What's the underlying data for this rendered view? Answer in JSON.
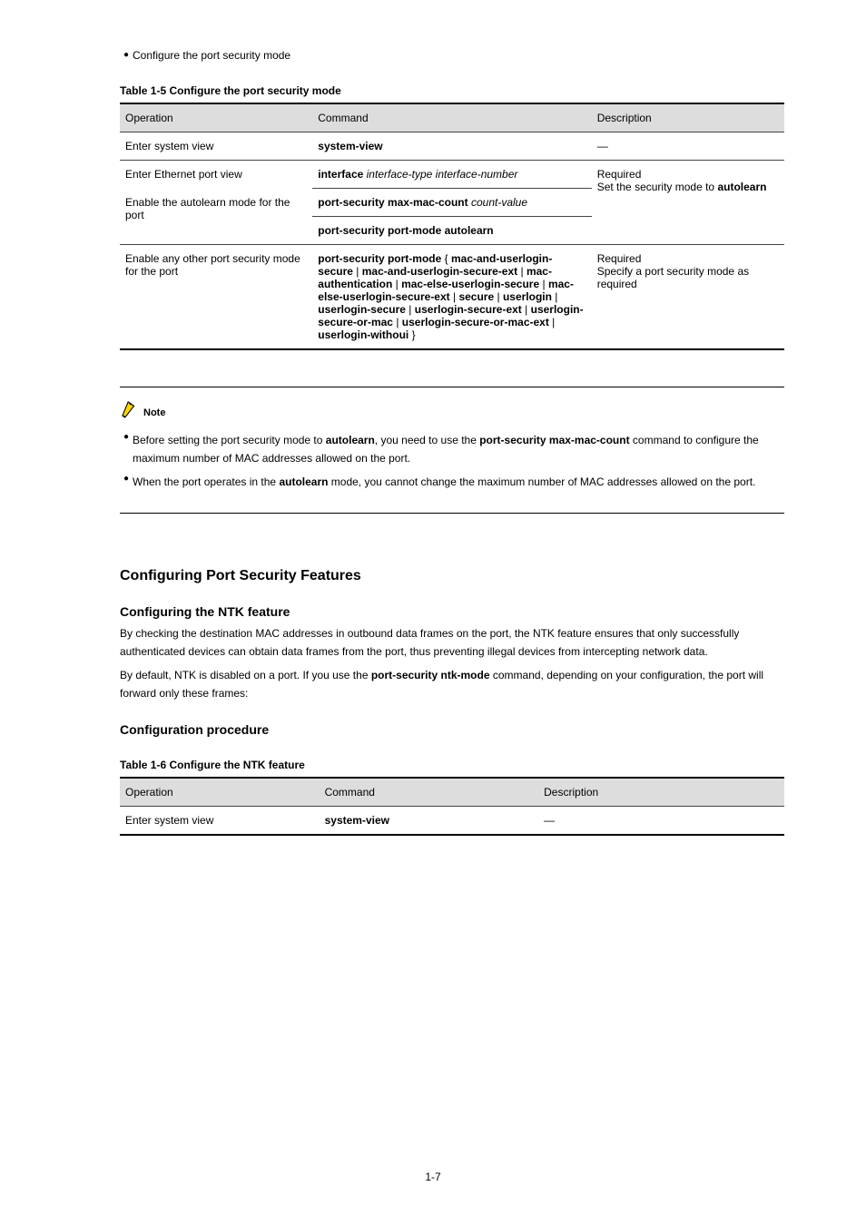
{
  "intro_bullet": "Configure the port security mode",
  "table1": {
    "caption": "Table 1-5 Configure the port security mode",
    "headers": [
      "Operation",
      "Command",
      "Description"
    ],
    "rows": [
      {
        "op": "Enter system view",
        "cmd": "system-view",
        "desc": "—"
      },
      {
        "op": "Enter Ethernet port view",
        "cmd": "interface interface-type interface-number",
        "desc": "",
        "desc_span": true
      },
      {
        "op": "Enable the autolearn mode for the port",
        "cmd": "port-security max-mac-count count-value",
        "desc": "Required\nSet the security mode to autolearn"
      },
      {
        "op": "",
        "cmd": "port-security port-mode autolearn",
        "desc": ""
      },
      {
        "op": "Enable any other port security mode for the port",
        "cmd": "port-security port-mode { mac-and-userlogin-secure | mac-and-userlogin-secure-ext | mac-authentication | mac-else-userlogin-secure | mac-else-userlogin-secure-ext | secure | userlogin | userlogin-secure | userlogin-secure-ext | userlogin-secure-or-mac | userlogin-secure-or-mac-ext | userlogin-withoui }",
        "desc": "Required\nSpecify a port security mode as required"
      }
    ]
  },
  "note": {
    "label": "Note",
    "items": [
      "Before setting the port security mode to autolearn, you need to use the port-security max-mac-count command to configure the maximum number of MAC addresses allowed on the port.",
      "When the port operates in the autolearn mode, you cannot change the maximum number of MAC addresses allowed on the port."
    ]
  },
  "h2": "Configuring Port Security Features",
  "h3a": "Configuring the NTK feature",
  "p1": "By checking the destination MAC addresses in outbound data frames on the port, the NTK feature ensures that only successfully authenticated devices can obtain data frames from the port, thus preventing illegal devices from intercepting network data.",
  "p2_pre": "By default, NTK is disabled on a port. If you use the ",
  "p2_cmd": "port-security ntk-mode",
  "p2_post": " command, depending on your configuration, the port will forward only these frames:",
  "h3b": "Configuration procedure",
  "table2": {
    "caption": "Table 1-6 Configure the NTK feature",
    "headers": [
      "Operation",
      "Command",
      "Description"
    ],
    "rows": [
      {
        "op": "Enter system view",
        "cmd": "system-view",
        "desc": "—"
      }
    ]
  },
  "footer": "1-7"
}
